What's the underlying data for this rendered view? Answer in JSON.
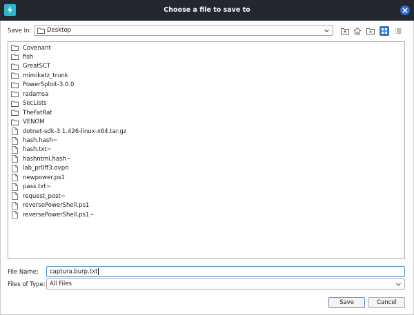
{
  "window": {
    "title": "Choose a file to save to",
    "app_icon": "lightning-bolt-icon",
    "close_icon": "close-icon"
  },
  "save_in": {
    "label": "Save In:",
    "value": "Desktop",
    "icon": "folder-icon"
  },
  "toolbar": {
    "buttons": [
      {
        "name": "up-folder-icon"
      },
      {
        "name": "home-icon"
      },
      {
        "name": "new-folder-icon"
      },
      {
        "name": "list-view-icon",
        "active": true
      },
      {
        "name": "details-view-icon"
      }
    ],
    "active_color": "#3474c7"
  },
  "files": [
    {
      "name": "Covenant",
      "type": "folder"
    },
    {
      "name": "fish",
      "type": "folder"
    },
    {
      "name": "GreatSCT",
      "type": "folder"
    },
    {
      "name": "mimikatz_trunk",
      "type": "folder"
    },
    {
      "name": "PowerSploit-3.0.0",
      "type": "folder"
    },
    {
      "name": "radamsa",
      "type": "folder"
    },
    {
      "name": "SecLists",
      "type": "folder"
    },
    {
      "name": "TheFatRat",
      "type": "folder"
    },
    {
      "name": "VENOM",
      "type": "folder"
    },
    {
      "name": "dotnet-sdk-3.1.426-linux-x64.tar.gz",
      "type": "file"
    },
    {
      "name": "hash.hash~",
      "type": "file"
    },
    {
      "name": "hash.txt~",
      "type": "file"
    },
    {
      "name": "hashntml.hash~",
      "type": "file"
    },
    {
      "name": "lab_pr0ff3.ovpn",
      "type": "file"
    },
    {
      "name": "newpower.ps1",
      "type": "file"
    },
    {
      "name": "pass.txt~",
      "type": "file"
    },
    {
      "name": "request_post~",
      "type": "file"
    },
    {
      "name": "reversePowerShell.ps1",
      "type": "file"
    },
    {
      "name": "reversePowerShell.ps1~",
      "type": "file"
    }
  ],
  "file_name": {
    "label": "File Name:",
    "value": "captura.burp.txt"
  },
  "files_of_type": {
    "label": "Files of Type:",
    "value": "All Files"
  },
  "buttons": {
    "save": "Save",
    "cancel": "Cancel"
  },
  "colors": {
    "titlebar": "#23272e",
    "accent": "#2f6bd6",
    "app_icon": "#2eb5c9"
  }
}
